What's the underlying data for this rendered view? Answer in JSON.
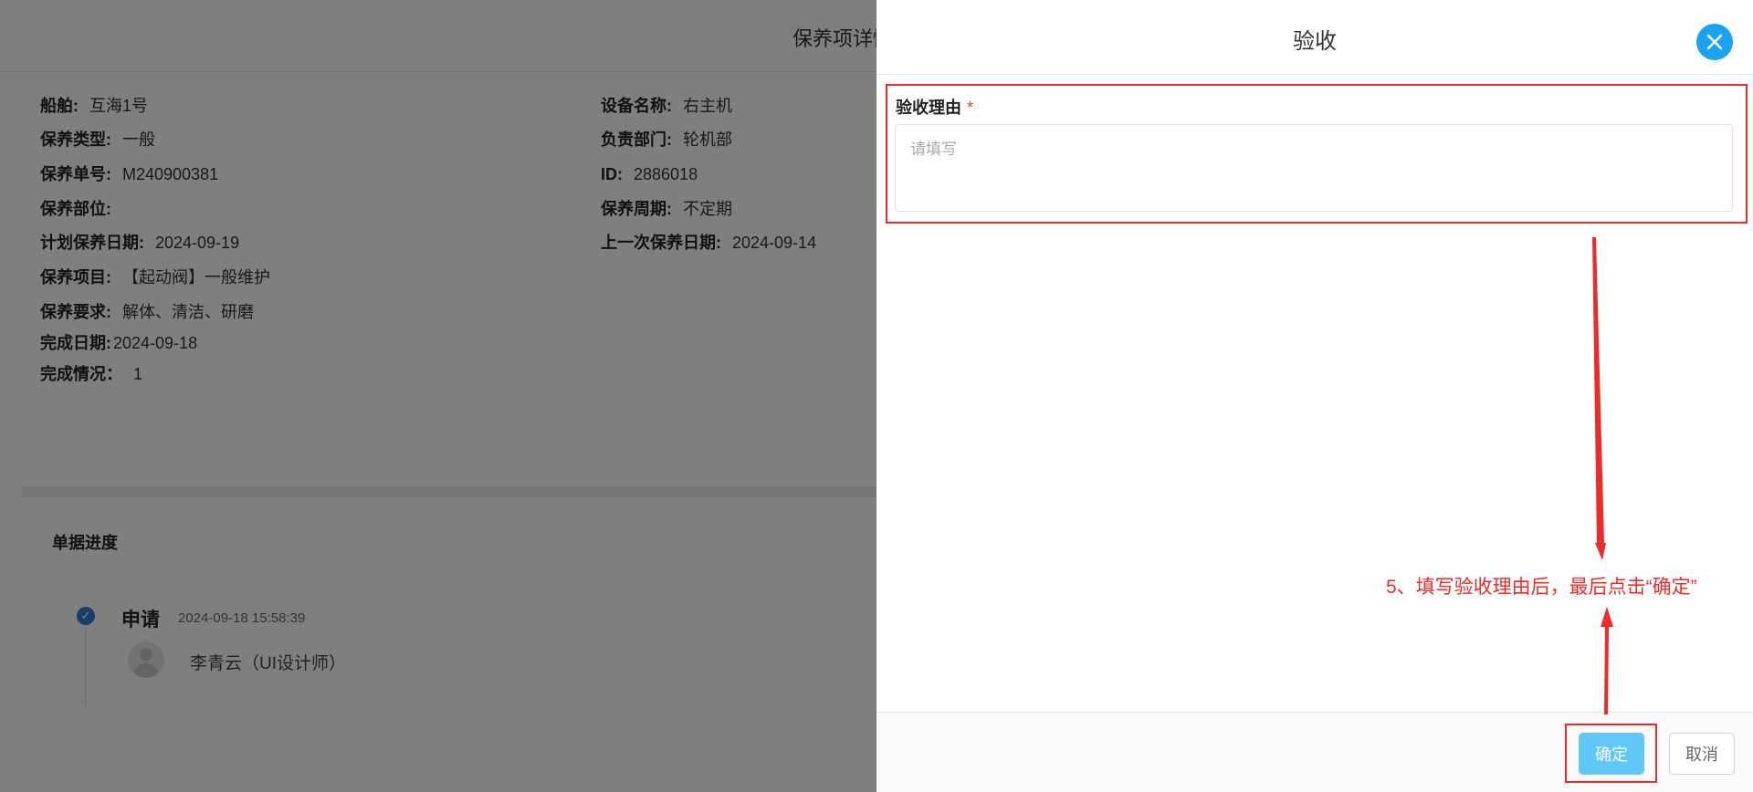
{
  "background_page": {
    "title": "保养项详情",
    "left_fields": [
      {
        "label": "船舶:",
        "value": "互海1号"
      },
      {
        "label": "保养类型:",
        "value": "一般"
      },
      {
        "label": "保养单号:",
        "value": "M240900381"
      },
      {
        "label": "保养部位:",
        "value": ""
      },
      {
        "label": "计划保养日期:",
        "value": "2024-09-19"
      },
      {
        "label": "保养项目:",
        "value": "【起动阀】一般维护"
      },
      {
        "label": "保养要求:",
        "value": "解体、清洁、研磨"
      },
      {
        "label": "完成日期:",
        "value": "2024-09-18"
      },
      {
        "label": "完成情况：",
        "value": "1"
      }
    ],
    "right_fields": [
      {
        "label": "设备名称:",
        "value": "右主机"
      },
      {
        "label": "负责部门:",
        "value": "轮机部"
      },
      {
        "label": "ID:",
        "value": "2886018"
      },
      {
        "label": "保养周期:",
        "value": "不定期"
      },
      {
        "label": "上一次保养日期:",
        "value": "2024-09-14"
      }
    ],
    "progress": {
      "section_title": "单据进度",
      "step_title": "申请",
      "step_time": "2024-09-18 15:58:39",
      "step_user": "李青云（UI设计师）"
    }
  },
  "drawer": {
    "title": "验收",
    "close_icon": "close-icon",
    "reason_label": "验收理由",
    "required_mark": "*",
    "reason_placeholder": "请填写",
    "reason_value": "",
    "confirm_label": "确定",
    "cancel_label": "取消"
  },
  "annotation": {
    "text": "5、填写验收理由后，最后点击“确定”",
    "color": "#ee2b2b"
  },
  "colors": {
    "close_button": "#1aa3f0",
    "confirm_button": "#5fc8f6",
    "step_check": "#2f7fd0",
    "mask": "rgba(0,0,0,0.5)"
  }
}
